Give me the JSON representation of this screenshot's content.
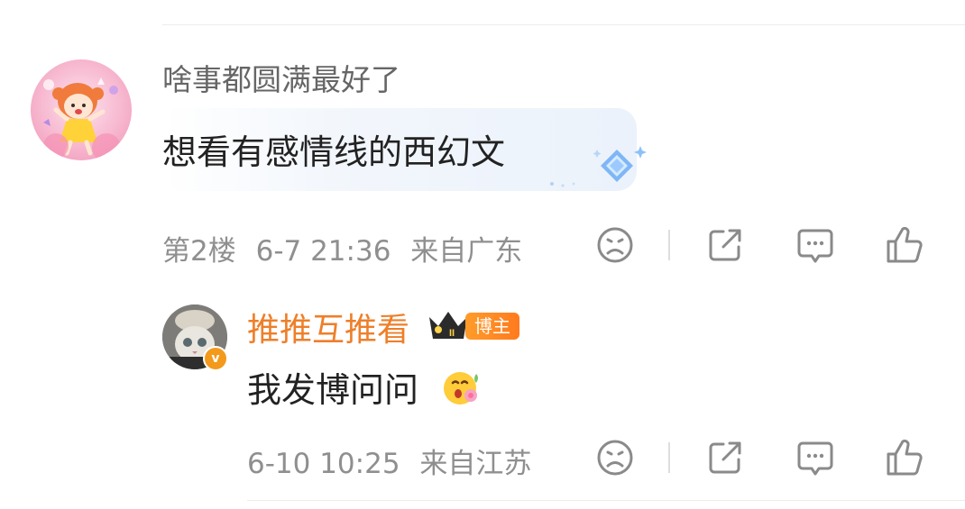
{
  "comment": {
    "username": "啥事都圆满最好了",
    "text": "想看有感情线的西幻文",
    "floor": "第2楼",
    "datetime": "6-7 21:36",
    "location": "来自广东"
  },
  "reply": {
    "username": "推推互推看",
    "badge_text": "博主",
    "crown_level": "II",
    "verified_mark": "v",
    "text": "我发博问问",
    "datetime": "6-10 10:25",
    "location": "来自江苏"
  },
  "icons": {
    "dislike": "sad-face-icon",
    "share": "share-icon",
    "comment": "comment-icon",
    "like": "thumbs-up-icon",
    "bubble_decoration": "diamond-sparkle-icon",
    "reply_emoji": "flower-face-emoji-icon"
  },
  "colors": {
    "username": "#666666",
    "blogger_name": "#ee7f2a",
    "meta": "#8f8f8f",
    "icon": "#8a8a8a",
    "badge": "#ff8a20"
  }
}
